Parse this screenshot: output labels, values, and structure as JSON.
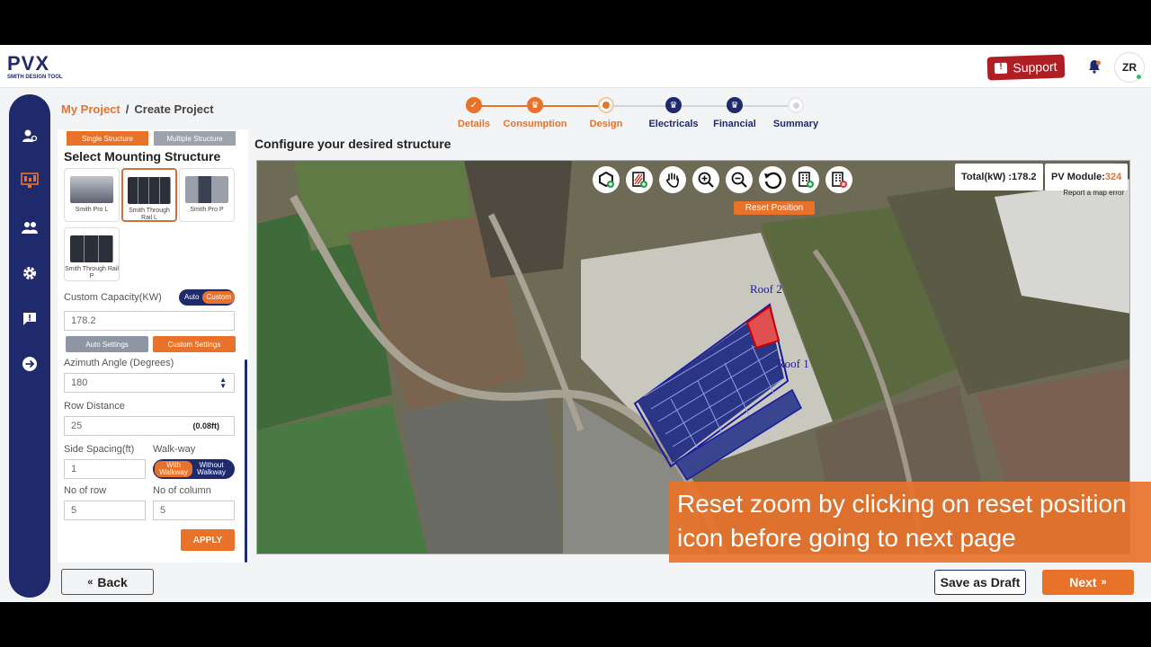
{
  "app": {
    "logo_main": "PVX",
    "logo_sub": "SMITH DESIGN TOOL",
    "support_label": "Support",
    "avatar_initials": "ZR"
  },
  "breadcrumb": {
    "link": "My Project",
    "separator": "/",
    "current": "Create Project"
  },
  "stepper": {
    "steps": [
      {
        "label": "Details",
        "state": "done"
      },
      {
        "label": "Consumption",
        "state": "done"
      },
      {
        "label": "Design",
        "state": "active"
      },
      {
        "label": "Electricals",
        "state": "pending"
      },
      {
        "label": "Financial",
        "state": "pending"
      },
      {
        "label": "Summary",
        "state": "pending"
      }
    ]
  },
  "panel": {
    "structure_tabs": [
      "Single Structure",
      "Multiple Structure"
    ],
    "section_title": "Select Mounting Structure",
    "structures": [
      {
        "label": "Smith Pro L",
        "selected": false
      },
      {
        "label": "Smith Through Rail L",
        "selected": true
      },
      {
        "label": "Smith Pro P",
        "selected": false
      },
      {
        "label": "Smith Through Rail P",
        "selected": false
      }
    ],
    "custom_capacity_label": "Custom Capacity(KW)",
    "capacity_toggle": [
      "Auto",
      "Custom"
    ],
    "custom_capacity_value": "178.2",
    "settings_buttons": [
      "Auto Settings",
      "Custom Settings"
    ],
    "azimuth_label": "Azimuth Angle (Degrees)",
    "azimuth_value": "180",
    "row_distance_label": "Row Distance",
    "row_distance_value": "25",
    "row_distance_ft": "(0.08ft)",
    "side_spacing_label": "Side Spacing(ft)",
    "side_spacing_value": "1",
    "walkway_label": "Walk-way",
    "walkway_toggle": [
      "With Walkway",
      "Without Walkway"
    ],
    "no_of_row_label": "No of row",
    "no_of_row_value": "5",
    "no_of_column_label": "No of column",
    "no_of_column_value": "5",
    "apply_label": "APPLY"
  },
  "main": {
    "title": "Configure your desired structure",
    "reset_tooltip": "Reset Position",
    "total_kw_label": "Total(kW) : ",
    "total_kw_value": "178.2",
    "pv_module_label": "PV Module:",
    "pv_module_value": "324",
    "map_error": "Report a map error",
    "roof_labels": [
      "Roof 2",
      "Roof 1"
    ],
    "caption": "Reset zoom by clicking on reset position icon before going to next page"
  },
  "footer": {
    "back_label": "Back",
    "draft_label": "Save as Draft",
    "next_label": "Next"
  },
  "colors": {
    "brand_navy": "#1e2a6b",
    "brand_orange": "#e8722a",
    "support_red": "#b01e24"
  }
}
